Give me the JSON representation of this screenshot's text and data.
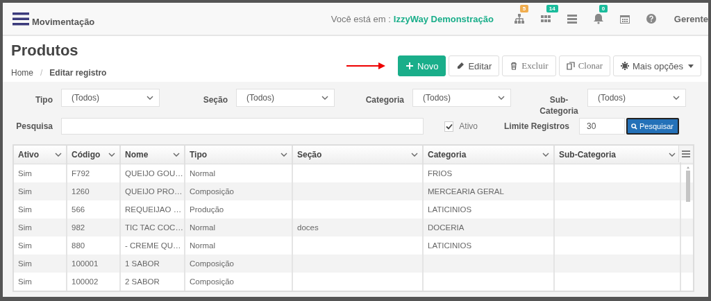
{
  "header": {
    "menu_title": "Movimentação",
    "location_prefix": "Você está em :",
    "location": "IzzyWay Demonstração",
    "icons": [
      {
        "kind": "sitemap",
        "badge": "5",
        "color": "#f0ad4e"
      },
      {
        "kind": "grid",
        "badge": "14",
        "color": "#1abc9c"
      },
      {
        "kind": "server"
      },
      {
        "kind": "bell",
        "badge": "0",
        "color": "#1abc9c"
      },
      {
        "kind": "calendar"
      },
      {
        "kind": "help"
      }
    ],
    "user": "Gerente"
  },
  "page": {
    "title": "Produtos",
    "breadcrumb": [
      "Home",
      "Editar registro"
    ],
    "separator": "/"
  },
  "toolbar": [
    {
      "kind": "new",
      "label": "Novo"
    },
    {
      "kind": "edit",
      "label": "Editar"
    },
    {
      "kind": "delete",
      "label": "Excluir"
    },
    {
      "kind": "clone",
      "label": "Clonar"
    },
    {
      "kind": "more",
      "label": "Mais opções"
    }
  ],
  "filters": {
    "selects": [
      {
        "label": "Tipo",
        "value": "(Todos)"
      },
      {
        "label": "Seção",
        "value": "(Todos)"
      },
      {
        "label": "Categoria",
        "value": "(Todos)"
      },
      {
        "label": "Sub-Categoria",
        "value": "(Todos)"
      }
    ],
    "search_label": "Pesquisa",
    "ativo": {
      "label": "Ativo",
      "checked": true
    },
    "limit_label": "Limite Registros",
    "limit_value": "30",
    "search_button": "Pesquisar"
  },
  "table": {
    "columns": [
      "Ativo",
      "Código",
      "Nome",
      "Tipo",
      "Seção",
      "Categoria",
      "Sub-Categoria"
    ],
    "rows": [
      [
        "Sim",
        "F792",
        "QUEIJO GOU…",
        "Normal",
        "",
        "FRIOS",
        ""
      ],
      [
        "Sim",
        "1260",
        "QUEIJO PRO…",
        "Composição",
        "",
        "MERCEARIA GERAL",
        ""
      ],
      [
        "Sim",
        "566",
        "REQUEIJAO …",
        "Produção",
        "",
        "LATICINIOS",
        ""
      ],
      [
        "Sim",
        "982",
        "TIC TAC COC…",
        "Normal",
        "doces",
        "DOCERIA",
        ""
      ],
      [
        "Sim",
        "880",
        "- CREME QU…",
        "Normal",
        "",
        "LATICINIOS",
        ""
      ],
      [
        "Sim",
        "100001",
        "1 SABOR",
        "Composição",
        "",
        "",
        ""
      ],
      [
        "Sim",
        "100002",
        "2 SABOR",
        "Composição",
        "",
        "",
        ""
      ]
    ]
  }
}
